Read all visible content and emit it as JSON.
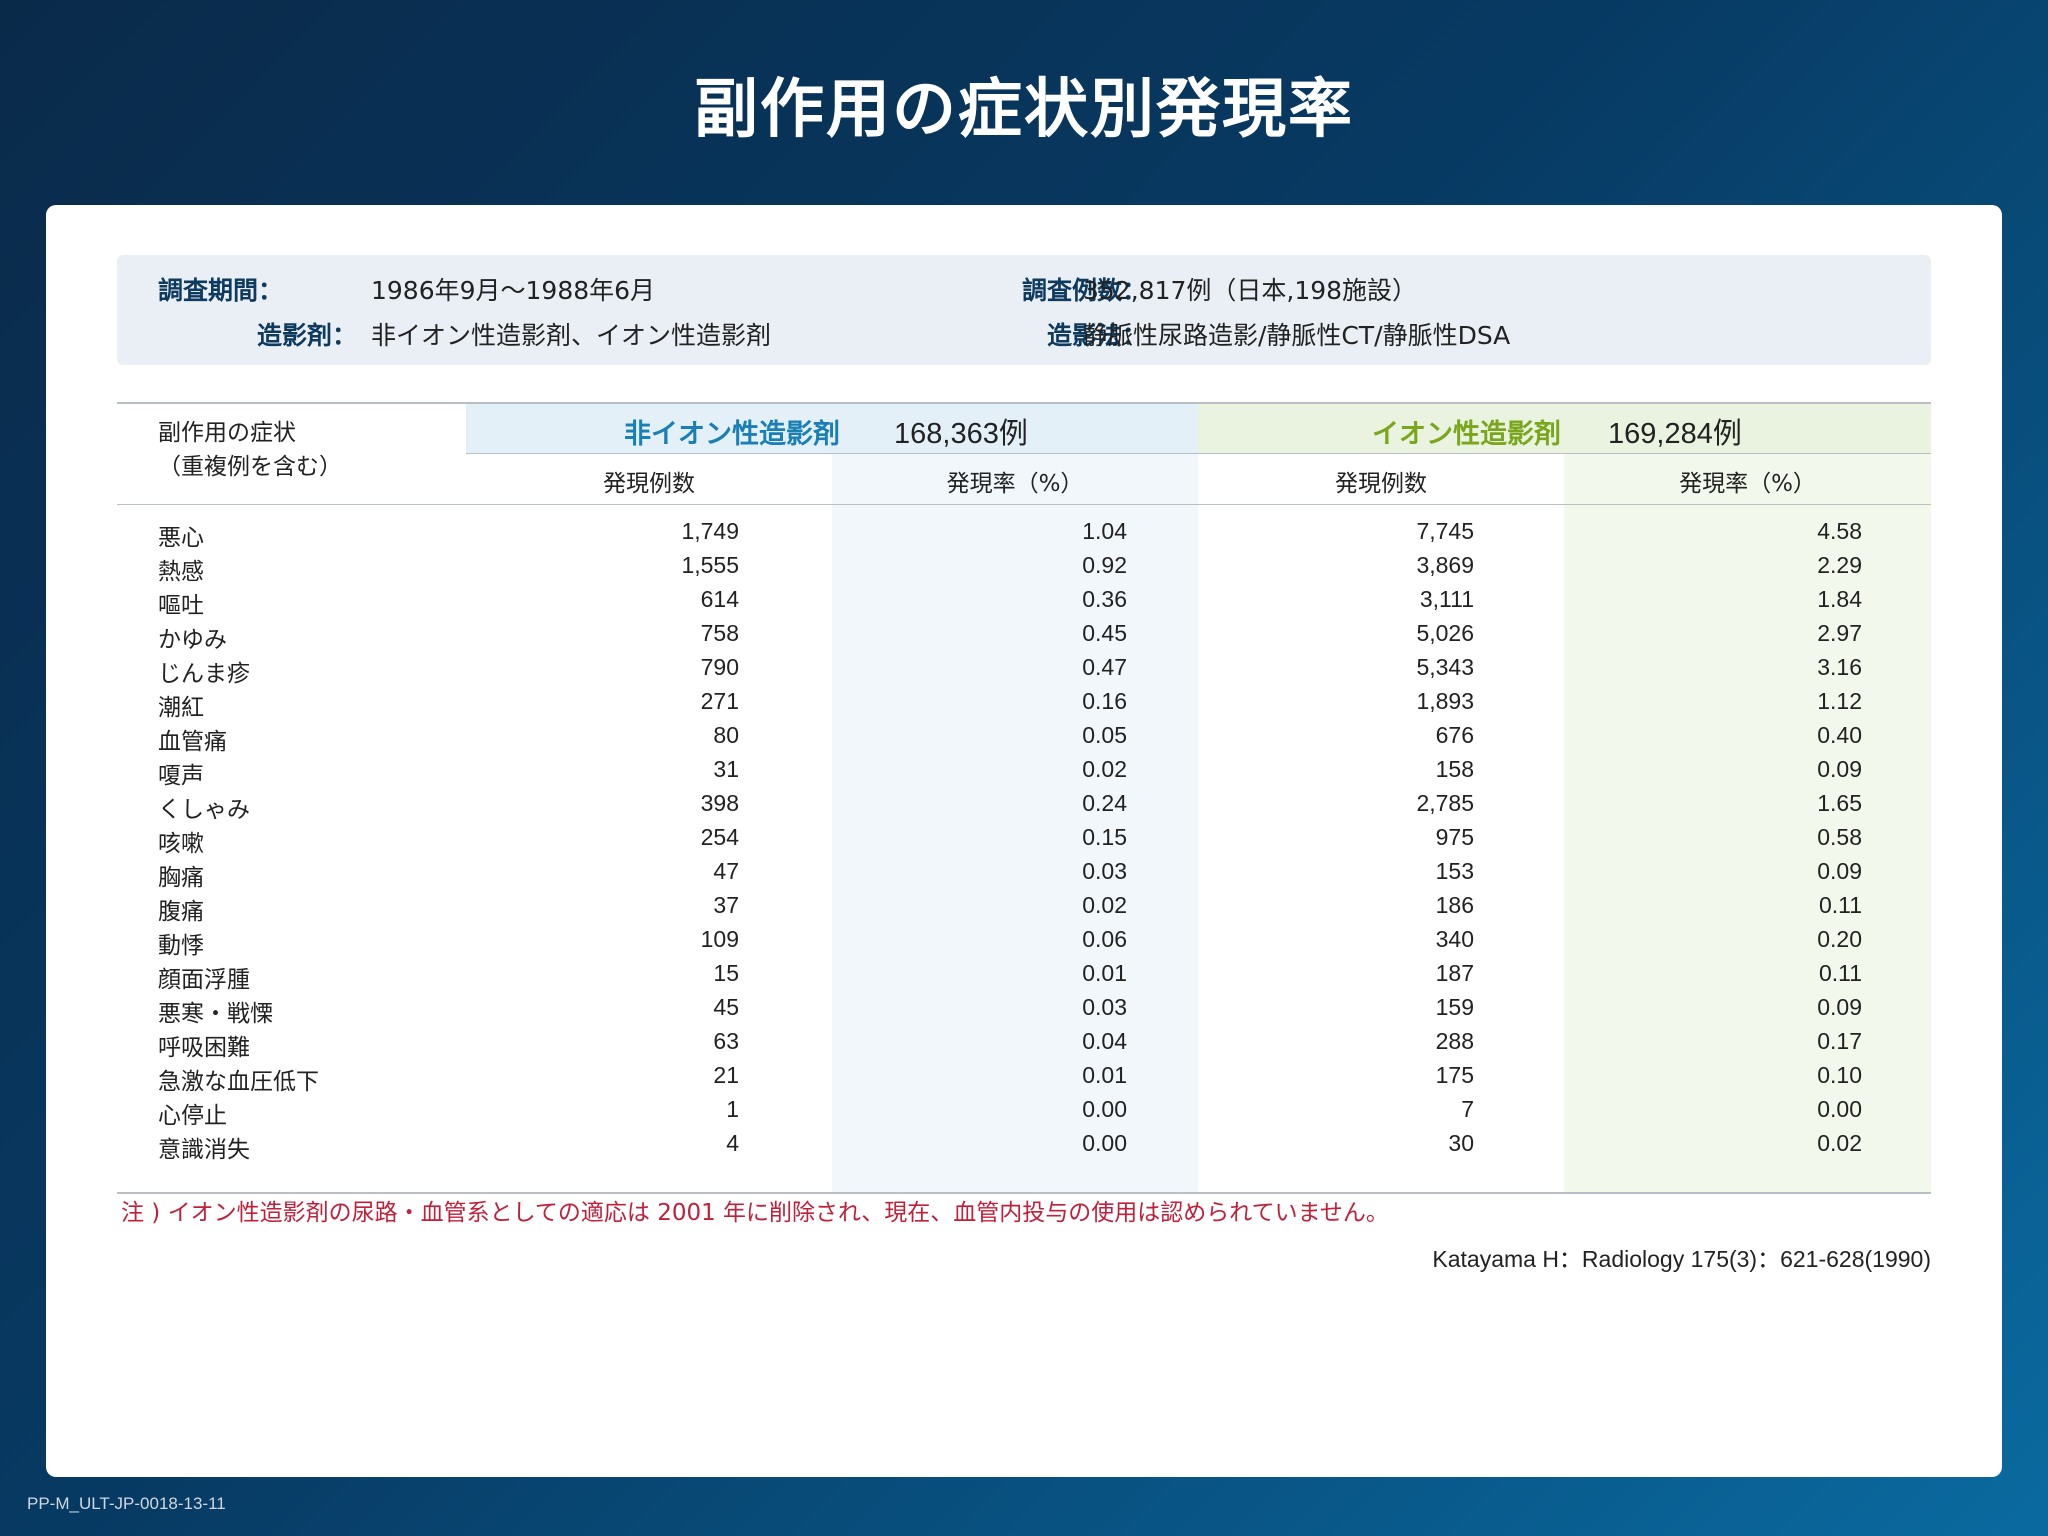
{
  "title": "副作用の症状別発現率",
  "survey": {
    "period_label": "調査期間：",
    "period_value": "1986年9月～1988年6月",
    "cases_label": "調査例数：",
    "cases_value": "352,817例（日本,198施設）",
    "agent_label": "造影剤：",
    "agent_value": "非イオン性造影剤、イオン性造影剤",
    "method_label": "造影法：",
    "method_value": "静脈性尿路造影/静脈性CT/静脈性DSA"
  },
  "table": {
    "symptom_header_1": "副作用の症状",
    "symptom_header_2": "（重複例を含む）",
    "group_nonionic": {
      "name": "非イオン性造影剤",
      "count": "168,363例",
      "color": "#1a7fb5"
    },
    "group_ionic": {
      "name": "イオン性造影剤",
      "count": "169,284例",
      "color": "#7aa61c"
    },
    "sub_cases": "発現例数",
    "sub_rate": "発現率（%）",
    "rows": [
      [
        "悪心",
        "1,749",
        "1.04",
        "7,745",
        "4.58"
      ],
      [
        "熱感",
        "1,555",
        "0.92",
        "3,869",
        "2.29"
      ],
      [
        "嘔吐",
        "614",
        "0.36",
        "3,111",
        "1.84"
      ],
      [
        "かゆみ",
        "758",
        "0.45",
        "5,026",
        "2.97"
      ],
      [
        "じんま疹",
        "790",
        "0.47",
        "5,343",
        "3.16"
      ],
      [
        "潮紅",
        "271",
        "0.16",
        "1,893",
        "1.12"
      ],
      [
        "血管痛",
        "80",
        "0.05",
        "676",
        "0.40"
      ],
      [
        "嗄声",
        "31",
        "0.02",
        "158",
        "0.09"
      ],
      [
        "くしゃみ",
        "398",
        "0.24",
        "2,785",
        "1.65"
      ],
      [
        "咳嗽",
        "254",
        "0.15",
        "975",
        "0.58"
      ],
      [
        "胸痛",
        "47",
        "0.03",
        "153",
        "0.09"
      ],
      [
        "腹痛",
        "37",
        "0.02",
        "186",
        "0.11"
      ],
      [
        "動悸",
        "109",
        "0.06",
        "340",
        "0.20"
      ],
      [
        "顔面浮腫",
        "15",
        "0.01",
        "187",
        "0.11"
      ],
      [
        "悪寒・戦慄",
        "45",
        "0.03",
        "159",
        "0.09"
      ],
      [
        "呼吸困難",
        "63",
        "0.04",
        "288",
        "0.17"
      ],
      [
        "急激な血圧低下",
        "21",
        "0.01",
        "175",
        "0.10"
      ],
      [
        "心停止",
        "1",
        "0.00",
        "7",
        "0.00"
      ],
      [
        "意識消失",
        "4",
        "0.00",
        "30",
        "0.02"
      ]
    ]
  },
  "note": "注 ) イオン性造影剤の尿路・血管系としての適応は 2001 年に削除され、現在、血管内投与の使用は認められていません。",
  "reference": "Katayama H：Radiology 175(3)：621-628(1990)",
  "doc_code": "PP-M_ULT-JP-0018-13-11"
}
